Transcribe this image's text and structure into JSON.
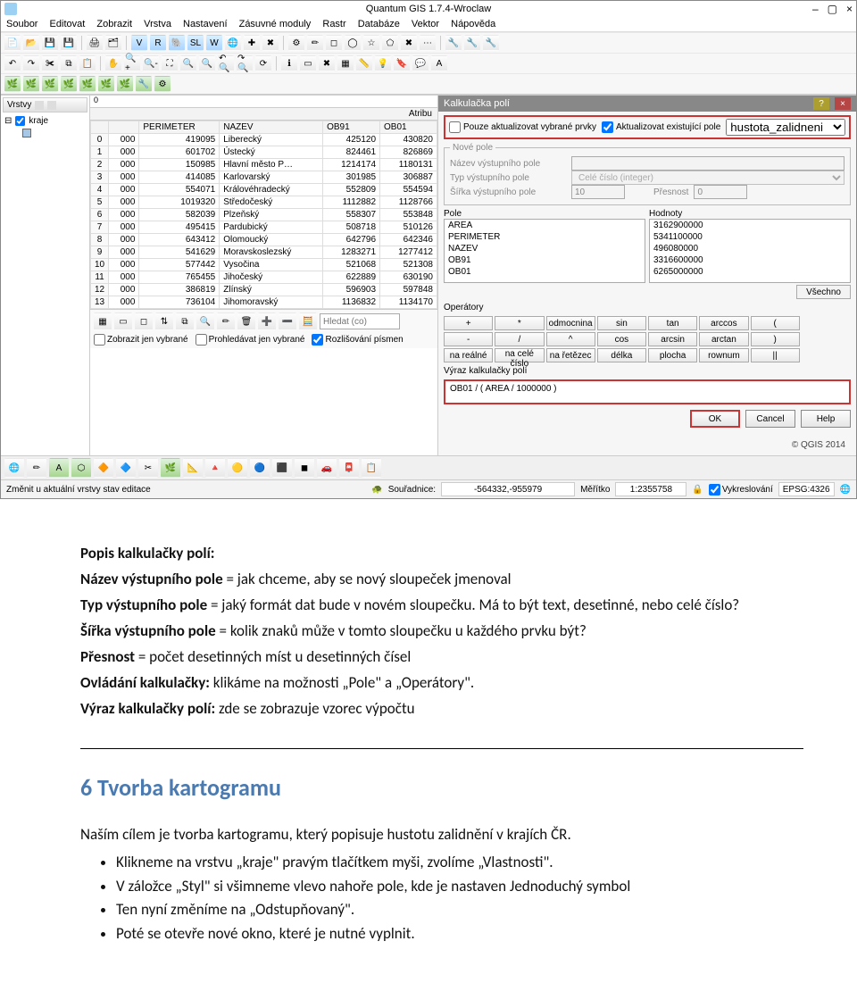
{
  "window": {
    "title": "Quantum GIS 1.7.4-Wroclaw",
    "min": "–",
    "max": "▢",
    "close": "×"
  },
  "menu": [
    "Soubor",
    "Editovat",
    "Zobrazit",
    "Vrstva",
    "Nastavení",
    "Zásuvné moduly",
    "Rastr",
    "Databáze",
    "Vektor",
    "Nápověda"
  ],
  "layers": {
    "panel_title": "Vrstvy",
    "item_label": "kraje"
  },
  "ruler_zero": "0",
  "attribute_panel_title": "Atribu",
  "table": {
    "headers": [
      "",
      "PERIMETER",
      "NAZEV",
      "OB91",
      "OB01"
    ],
    "rows": [
      [
        "0",
        "000",
        "419095",
        "Liberecký",
        "425120",
        "430820"
      ],
      [
        "1",
        "000",
        "601702",
        "Ústecký",
        "824461",
        "826869"
      ],
      [
        "2",
        "000",
        "150985",
        "Hlavní město P…",
        "1214174",
        "1180131"
      ],
      [
        "3",
        "000",
        "414085",
        "Karlovarský",
        "301985",
        "306887"
      ],
      [
        "4",
        "000",
        "554071",
        "Královéhradecký",
        "552809",
        "554594"
      ],
      [
        "5",
        "000",
        "1019320",
        "Středočeský",
        "1112882",
        "1128766"
      ],
      [
        "6",
        "000",
        "582039",
        "Plzeňský",
        "558307",
        "553848"
      ],
      [
        "7",
        "000",
        "495415",
        "Pardubický",
        "508718",
        "510126"
      ],
      [
        "8",
        "000",
        "643412",
        "Olomoucký",
        "642796",
        "642346"
      ],
      [
        "9",
        "000",
        "541629",
        "Moravskoslezský",
        "1283271",
        "1277412"
      ],
      [
        "10",
        "000",
        "577442",
        "Vysočina",
        "521068",
        "521308"
      ],
      [
        "11",
        "000",
        "765455",
        "Jihočeský",
        "622889",
        "630190"
      ],
      [
        "12",
        "000",
        "386819",
        "Zlínský",
        "596903",
        "597848"
      ],
      [
        "13",
        "000",
        "736104",
        "Jihomoravský",
        "1136832",
        "1134170"
      ]
    ]
  },
  "attr_bottom": {
    "search_placeholder": "Hledat (co)",
    "chk1": "Zobrazit jen vybrané",
    "chk2": "Prohledávat jen vybrané",
    "chk3": "Rozlišování písmen"
  },
  "statusbar": {
    "left_text": "Změnit u aktuální vrstvy stav editace",
    "coord_label": "Souřadnice:",
    "coord_value": "-564332,-955979",
    "scale_label": "Měřítko",
    "scale_value": "1:2355758",
    "render_label": "Vykreslování",
    "srs": "EPSG:4326"
  },
  "dialog": {
    "title": "Kalkulačka polí",
    "only_selected": "Pouze aktualizovat vybrané prvky",
    "update_existing": "Aktualizovat existující pole",
    "existing_field": "hustota_zalidneni",
    "group_newfield": "Nové pole",
    "label_name": "Název výstupního pole",
    "label_type": "Typ výstupního pole",
    "type_value": "Celé číslo (integer)",
    "label_width": "Šířka výstupního pole",
    "width_value": "10",
    "label_prec": "Přesnost",
    "prec_value": "0",
    "fields_label": "Pole",
    "values_label": "Hodnoty",
    "fields_list": [
      "AREA",
      "PERIMETER",
      "NAZEV",
      "OB91",
      "OB01"
    ],
    "values_list": [
      "3162900000",
      "5341100000",
      "496080000",
      "3316600000",
      "6265000000"
    ],
    "all_btn": "Všechno",
    "ops_label": "Operátory",
    "ops": [
      "+",
      "*",
      "odmocnina",
      "sin",
      "tan",
      "arccos",
      "(",
      "-",
      "/",
      "^",
      "cos",
      "arcsin",
      "arctan",
      ")",
      "na reálné",
      "na celé číslo",
      "na řetězec",
      "délka",
      "plocha",
      "rownum",
      "||"
    ],
    "expr_label": "Výraz kalkulačky polí",
    "expression": "OB01 / ( AREA / 1000000 )",
    "ok": "OK",
    "cancel": "Cancel",
    "help": "Help",
    "copyright": "© QGIS 2014"
  },
  "doc": {
    "h_popis": "Popis kalkulačky polí:",
    "l1a": "Název výstupního pole",
    "l1b": " = jak chceme, aby se nový sloupeček jmenoval",
    "l2a": "Typ výstupního pole",
    "l2b": " = jaký formát dat bude v novém sloupečku. Má to být text, desetinné, nebo celé číslo?",
    "l3a": "Šířka výstupního pole",
    "l3b": " = kolik znaků může v tomto sloupečku u každého prvku být?",
    "l4a": "Přesnost",
    "l4b": " = počet desetinných míst u desetinných čísel",
    "l5a": "Ovládání kalkulačky:",
    "l5b": " klikáme na možnosti „Pole\" a „Operátory\".",
    "l6a": "Výraz kalkulačky polí:",
    "l6b": " zde se zobrazuje vzorec výpočtu",
    "h2": "6  Tvorba kartogramu",
    "p1": "Naším cílem je tvorba kartogramu, který popisuje hustotu zalidnění v krajích ČR.",
    "b1": "Klikneme na vrstvu „kraje\" pravým tlačítkem myši, zvolíme „Vlastnosti\".",
    "b2": "V záložce „Styl\" si všimneme vlevo nahoře pole, kde je nastaven Jednoduchý symbol",
    "b3": "Ten nyní změníme na „Odstupňovaný\".",
    "b4": "Poté se otevře nové okno, které je nutné vyplnit."
  }
}
